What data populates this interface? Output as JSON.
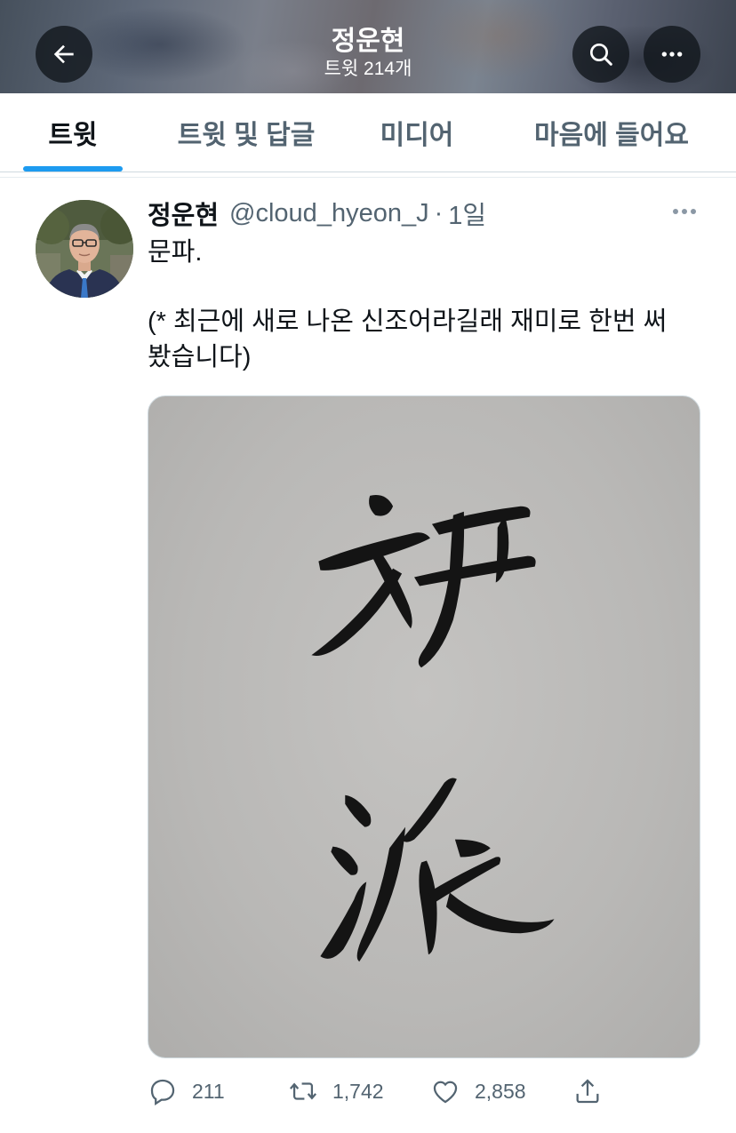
{
  "header": {
    "title": "정운현",
    "subtitle": "트윗 214개",
    "back_icon": "arrow-left-icon",
    "search_icon": "search-icon",
    "more_icon": "more-horizontal-icon"
  },
  "tabs": [
    {
      "label": "트윗",
      "active": true
    },
    {
      "label": "트윗 및 답글",
      "active": false
    },
    {
      "label": "미디어",
      "active": false
    },
    {
      "label": "마음에 들어요",
      "active": false
    }
  ],
  "tweet": {
    "display_name": "정운현",
    "handle": "@cloud_hyeon_J",
    "separator": "·",
    "time": "1일",
    "text_line1": "문파.",
    "text_line2": "(* 최근에 새로 나온 신조어라길래 재미로 한번 써",
    "text_line3": "봤습니다)",
    "stats": {
      "replies": "211",
      "retweets": "1,742",
      "likes": "2,858"
    }
  },
  "colors": {
    "accent": "#1d9bf0",
    "text_primary": "#0f1419",
    "text_secondary": "#536471",
    "border": "#cfd9de"
  }
}
